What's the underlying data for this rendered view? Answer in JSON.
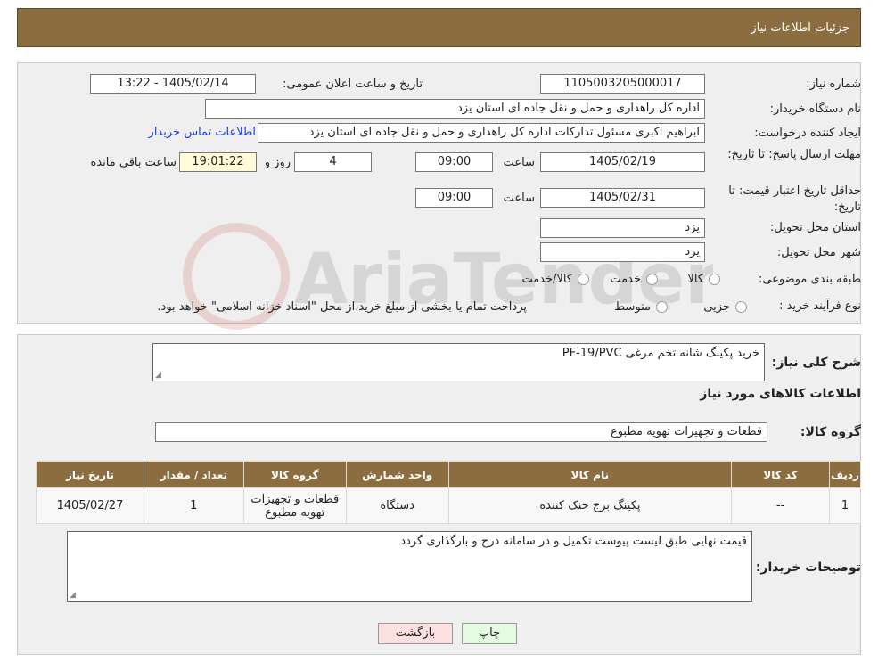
{
  "header": {
    "title": "جزئیات اطلاعات نیاز"
  },
  "labels": {
    "need_number": "شماره نیاز:",
    "announce_datetime": "تاریخ و ساعت اعلان عمومی:",
    "buyer_org": "نام دستگاه خریدار:",
    "requester": "ایجاد کننده درخواست:",
    "contact_link": "اطلاعات تماس خریدار",
    "reply_deadline": "مهلت ارسال پاسخ: تا تاریخ:",
    "time": "ساعت",
    "day_and": "روز و",
    "remaining": "ساعت باقی مانده",
    "price_validity": "حداقل تاریخ اعتبار قیمت: تا تاریخ:",
    "province": "استان محل تحویل:",
    "city": "شهر محل تحویل:",
    "category": "طبقه بندی موضوعی:",
    "process_type": "نوع فرآیند خرید :",
    "need_summary": "شرح کلی نیاز:",
    "goods_info": "اطلاعات کالاهای مورد نیاز",
    "goods_group": "گروه کالا:",
    "buyer_notes": "توضیحات خریدار:"
  },
  "values": {
    "need_number": "1105003205000017",
    "announce_datetime": "1405/02/14 - 13:22",
    "buyer_org": "اداره کل راهداری و حمل و نقل جاده ای استان یزد",
    "requester": "ابراهیم اکبری مسئول تدارکات اداره کل راهداری و حمل و نقل جاده ای استان یزد",
    "reply_date": "1405/02/19",
    "reply_time": "09:00",
    "days": "4",
    "remaining_time": "19:01:22",
    "validity_date": "1405/02/31",
    "validity_time": "09:00",
    "province": "یزد",
    "city": "یزد",
    "need_summary": "خرید پکینگ شانه تخم مرغی PF-19/PVC",
    "goods_group": "قطعات و تجهیزات تهویه مطبوع",
    "buyer_notes": "قیمت نهایی طبق لیست پیوست تکمیل و در سامانه درج و بارگذاری گردد"
  },
  "category_options": [
    {
      "label": "کالا",
      "selected": false
    },
    {
      "label": "خدمت",
      "selected": false
    },
    {
      "label": "کالا/خدمت",
      "selected": false
    }
  ],
  "process_options": [
    {
      "label": "جزیی",
      "selected": false
    },
    {
      "label": "متوسط",
      "selected": false
    }
  ],
  "process_note": "پرداخت تمام یا بخشی از مبلغ خرید،از محل \"اسناد خزانه اسلامی\" خواهد بود.",
  "table": {
    "headers": [
      "ردیف",
      "کد کالا",
      "نام کالا",
      "واحد شمارش",
      "گروه کالا",
      "تعداد / مقدار",
      "تاریخ نیاز"
    ],
    "rows": [
      [
        "1",
        "--",
        "پکینگ برج خنک کننده",
        "دستگاه",
        "قطعات و تجهیزات تهویه مطبوع",
        "1",
        "1405/02/27"
      ]
    ]
  },
  "buttons": {
    "print": "چاپ",
    "back": "بازگشت"
  },
  "watermark": {
    "text": "AriaTender.neT"
  },
  "colors": {
    "header_bg": "#8c6d3f",
    "link": "#1a3fd8",
    "panel_bg": "#efefef"
  }
}
